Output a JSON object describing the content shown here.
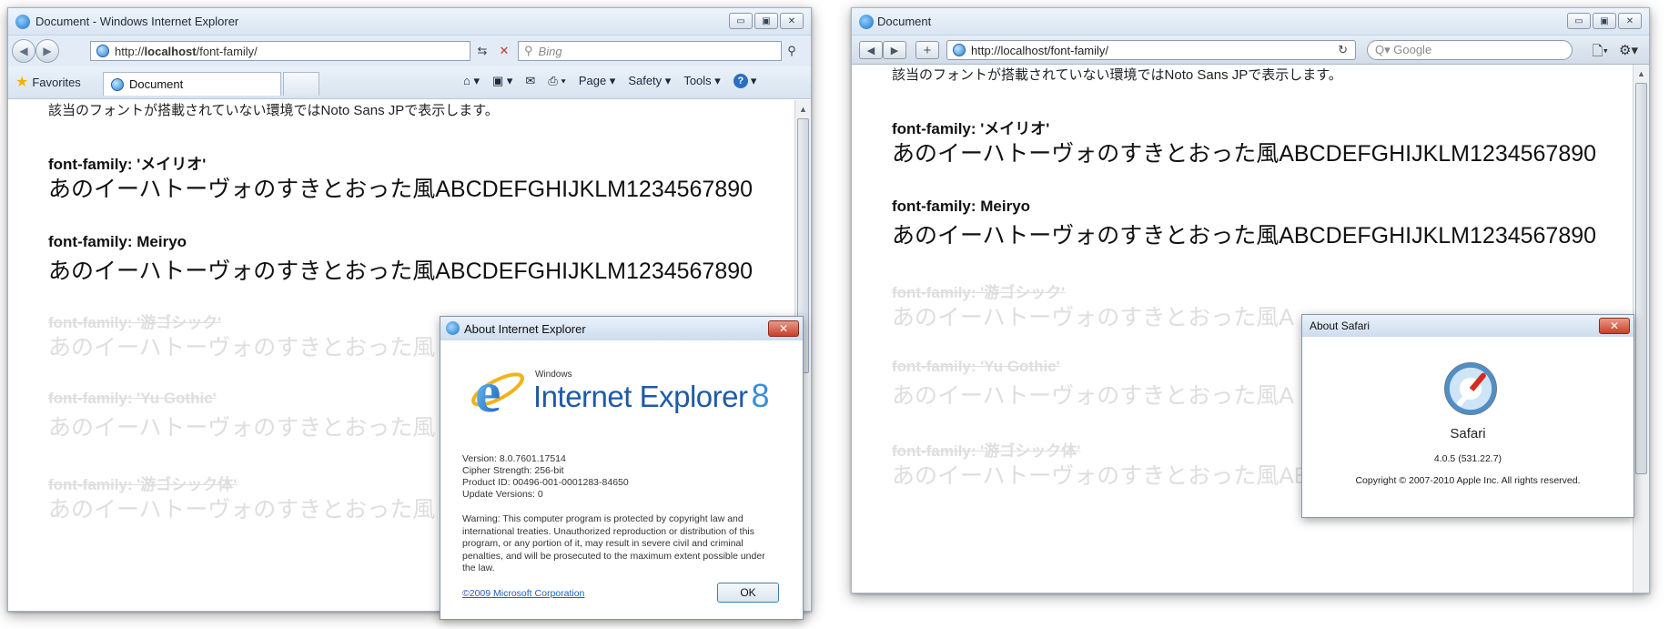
{
  "ie": {
    "window_title": "Document - Windows Internet Explorer",
    "caption_buttons": {
      "minimize": "▭",
      "maximize": "▣",
      "close": "✕"
    },
    "address_prefix": "http://",
    "address_host": "localhost",
    "address_path": "/font-family/",
    "search_placeholder": "Bing",
    "favorites_label": "Favorites",
    "tab_label": "Document",
    "commands": {
      "page": "Page ▾",
      "safety": "Safety ▾",
      "tools": "Tools ▾",
      "help": "?"
    },
    "page": {
      "note": "該当のフォントが搭載されていない環境ではNoto Sans JPで表示します。",
      "blocks": [
        {
          "label": "font-family: 'メイリオ'",
          "sample": "あのイーハトーヴォのすきとおった風ABCDEFGHIJKLM1234567890",
          "faded": false
        },
        {
          "label": "font-family: Meiryo",
          "sample": "あのイーハトーヴォのすきとおった風ABCDEFGHIJKLM1234567890",
          "faded": false
        },
        {
          "label": "font-family: '游ゴシック'",
          "sample": "あのイーハトーヴォのすきとおった風",
          "faded": true
        },
        {
          "label": "font-family: 'Yu Gothic'",
          "sample": "あのイーハトーヴォのすきとおった風",
          "faded": true
        },
        {
          "label": "font-family: '游ゴシック体'",
          "sample": "あのイーハトーヴォのすきとおった風",
          "faded": true
        }
      ]
    },
    "about": {
      "title": "About Internet Explorer",
      "logo_windows": "Windows",
      "logo_brand": "Internet Explorer",
      "logo_version": "8",
      "version": "Version: 8.0.7601.17514",
      "cipher": "Cipher Strength: 256-bit",
      "product_id": "Product ID: 00496-001-0001283-84650",
      "update": "Update Versions: 0",
      "warning": "Warning: This computer program is protected by copyright law and international treaties. Unauthorized reproduction or distribution of this program, or any portion of it, may result in severe civil and criminal penalties, and will be prosecuted to the maximum extent possible under the law.",
      "link": "©2009 Microsoft Corporation",
      "ok": "OK"
    }
  },
  "safari": {
    "window_title": "Document",
    "caption_buttons": {
      "minimize": "▭",
      "maximize": "▣",
      "close": "✕"
    },
    "back": "◀",
    "forward": "▶",
    "add": "+",
    "address": "http://localhost/font-family/",
    "reload": "↻",
    "search_placeholder": "Q▾ Google",
    "page_menu": "🗋▾",
    "gear_menu": "⚙▾",
    "page": {
      "note": "該当のフォントが搭載されていない環境ではNoto Sans JPで表示します。",
      "blocks": [
        {
          "label": "font-family: 'メイリオ'",
          "sample": "あのイーハトーヴォのすきとおった風ABCDEFGHIJKLM1234567890",
          "faded": false
        },
        {
          "label": "font-family: Meiryo",
          "sample": "あのイーハトーヴォのすきとおった風ABCDEFGHIJKLM1234567890",
          "faded": false
        },
        {
          "label": "font-family: '游ゴシック'",
          "sample": "あのイーハトーヴォのすきとおった風A",
          "faded": true
        },
        {
          "label": "font-family: 'Yu Gothic'",
          "sample": "あのイーハトーヴォのすきとおった風A",
          "faded": true
        },
        {
          "label": "font-family: '游ゴシック体'",
          "sample": "あのイーハトーヴォのすきとおった風ABCDEFGHIJKLM1234567890",
          "faded": true
        }
      ]
    },
    "about": {
      "title": "About Safari",
      "name": "Safari",
      "version": "4.0.5 (531.22.7)",
      "copyright": "Copyright © 2007-2010 Apple Inc. All rights reserved."
    }
  }
}
